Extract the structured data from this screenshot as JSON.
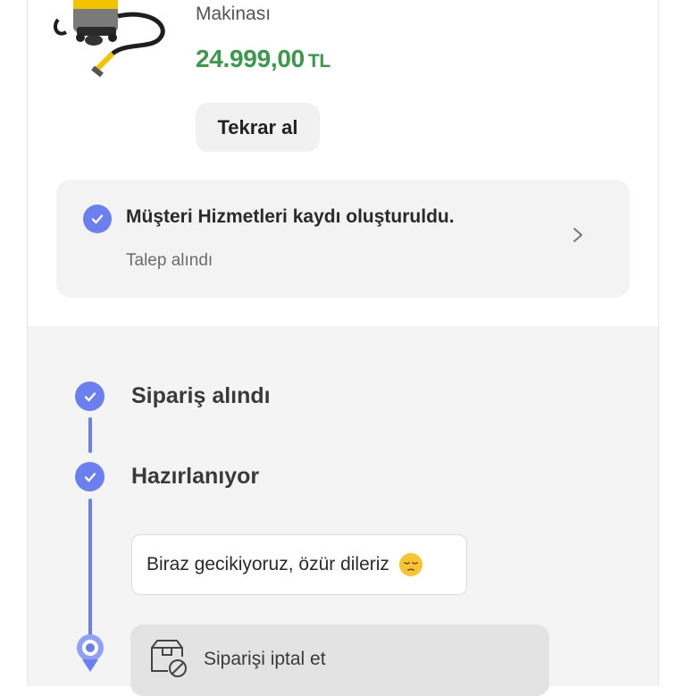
{
  "product": {
    "name_line": "Makinası",
    "price": "24.999,00",
    "currency": "TL",
    "rebuy_label": "Tekrar al"
  },
  "customer_service": {
    "title": "Müşteri Hizmetleri kaydı oluşturuldu.",
    "subtitle": "Talep alındı"
  },
  "tracking": {
    "steps": [
      {
        "label": "Sipariş alındı"
      },
      {
        "label": "Hazırlanıyor"
      }
    ],
    "delay_message": "Biraz gecikiyoruz, özür dileriz",
    "cancel_label": "Siparişi iptal et"
  },
  "colors": {
    "accent": "#6a7ff0",
    "price": "#3a9a4a"
  }
}
